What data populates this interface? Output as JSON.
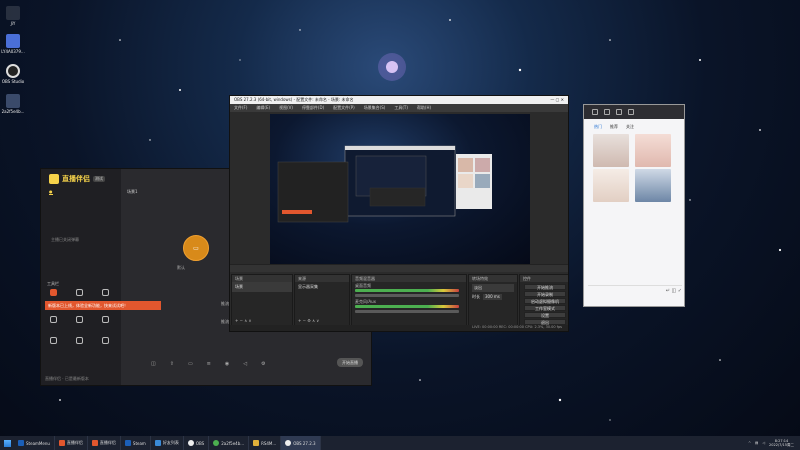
{
  "desktop": {
    "icons": [
      {
        "label": "JiY",
        "icon": "app-icon"
      },
      {
        "label": "LY4A0379...",
        "icon": "file-icon"
      },
      {
        "label": "OBS Studio",
        "icon": "obs-icon"
      },
      {
        "label": "2a2f5e4b...",
        "icon": "file-icon"
      }
    ]
  },
  "live_window": {
    "app_name": "直播伴侣",
    "badge": "测试",
    "notice": "新版本已上线，体验全新功能，快来试试吧！",
    "side_label": "工具栏",
    "hint_text": "主播已关闭弹幕",
    "scene_label": "场景1",
    "circle_left": "默认",
    "circle_right": "OBS LINK",
    "circle_right_sub": "优先推荐使用",
    "field_1": "推流地址",
    "field_2": "推流码",
    "start_label": "开始直播",
    "footer_text": "直播伴侣 · 已是最新版本"
  },
  "obs": {
    "title": "OBS 27.2.3 (64-bit, windows) - 配置文件: 未命名 - 场景: 未命名",
    "menu": [
      "文件(F)",
      "编辑(E)",
      "视图(V)",
      "停靠部件(D)",
      "配置文件(P)",
      "场景集合(S)",
      "工具(T)",
      "帮助(H)"
    ],
    "docks": {
      "scenes": "场景",
      "sources": "来源",
      "mixer": "音频混音器",
      "transitions": "转场特效",
      "controls": "控件"
    },
    "scene_item": "场景",
    "source_item": "显示器采集",
    "mixer_channels": [
      "桌面音频",
      "麦克风/Aux"
    ],
    "transition_type": "淡出",
    "duration_label": "时长",
    "duration_value": "300 ms",
    "controls": [
      "开始推流",
      "开始录制",
      "启动虚拟摄像机",
      "工作室模式",
      "设置",
      "退出"
    ],
    "status": "LIVE: 00:00:00   REC: 00:00:00   CPU: 2.3%, 30.00 fps"
  },
  "chat_window": {
    "tabs": [
      "热门",
      "推荐",
      "关注"
    ],
    "active_tab": 0
  },
  "taskbar": {
    "items": [
      {
        "label": "SteamMenu",
        "active": false
      },
      {
        "label": "直播伴侣",
        "active": false
      },
      {
        "label": "直播伴侣",
        "active": false
      },
      {
        "label": "Steam",
        "active": false
      },
      {
        "label": "好友列表",
        "active": false
      },
      {
        "label": "OBS",
        "active": false
      },
      {
        "label": "2a2f5e4b...",
        "active": false
      },
      {
        "label": "RS4M...",
        "active": false
      },
      {
        "label": "OBS 27.2.3",
        "active": true
      }
    ],
    "time": "8:27:14",
    "date": "2022/7/15周二"
  }
}
